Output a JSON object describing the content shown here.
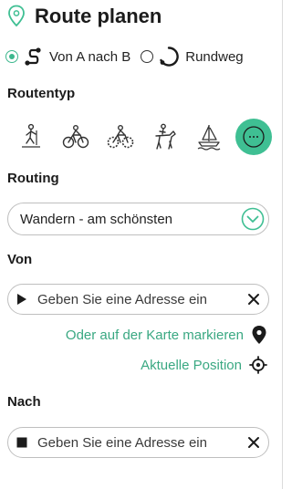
{
  "header": {
    "title": "Route planen"
  },
  "mode": {
    "a_to_b_label": "Von A nach B",
    "roundtrip_label": "Rundweg",
    "selected": "a_to_b"
  },
  "route_type": {
    "label": "Routentyp",
    "items": [
      {
        "icon": "hiking-icon"
      },
      {
        "icon": "bicycle-icon"
      },
      {
        "icon": "mountain-bike-icon"
      },
      {
        "icon": "horse-riding-icon"
      },
      {
        "icon": "boat-icon"
      },
      {
        "icon": "more-icon",
        "active": true
      }
    ]
  },
  "routing": {
    "label": "Routing",
    "value": "Wandern - am schönsten"
  },
  "from": {
    "label": "Von",
    "placeholder": "Geben Sie eine Adresse ein",
    "map_link": "Oder auf der Karte markieren",
    "position_link": "Aktuelle Position"
  },
  "to": {
    "label": "Nach",
    "placeholder": "Geben Sie eine Adresse ein"
  },
  "colors": {
    "accent": "#3fbf93",
    "link": "#3aa882",
    "border": "#bfbfbf"
  }
}
